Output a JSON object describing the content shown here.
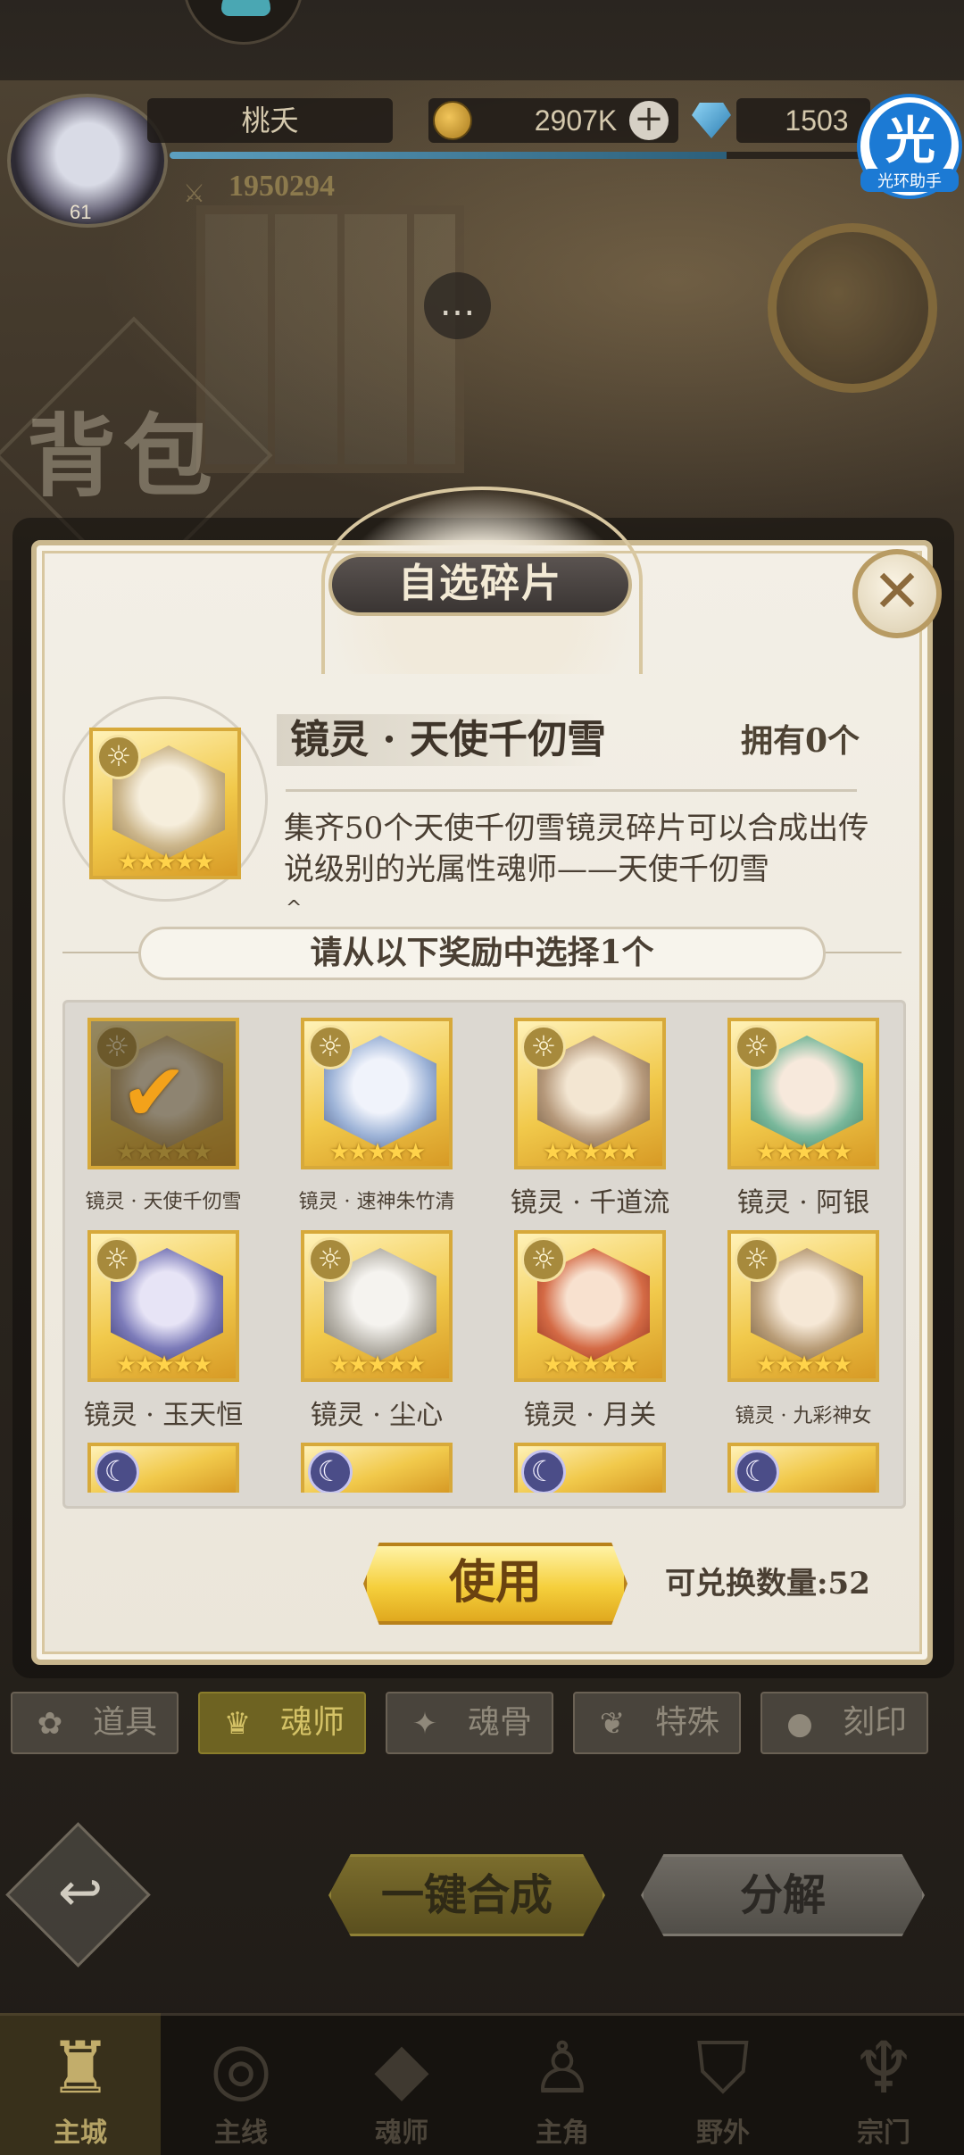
{
  "hud": {
    "player_name": "桃夭",
    "level": "61",
    "coins": "2907K",
    "gems": "1503",
    "power": "1950294",
    "exp_fraction": 0.8
  },
  "helper": {
    "glyph": "光",
    "label": "光环助手"
  },
  "page": {
    "title": "背包"
  },
  "dialog": {
    "title": "自选碎片",
    "close_glyph": "✕",
    "featured": {
      "name": "镜灵 · 天使千仞雪",
      "owned": "拥有0个",
      "description": "集齐50个天使千仞雪镜灵碎片可以合成出传说级别的光属性魂师——天使千仞雪",
      "stars": "★★★★★"
    },
    "choose_prompt": "请从以下奖励中选择1个",
    "items": [
      {
        "label": "镜灵 · 天使千仞雪",
        "element": "sun-icon",
        "selected": true
      },
      {
        "label": "镜灵 · 速神朱竹清",
        "element": "sun-icon",
        "selected": false
      },
      {
        "label": "镜灵 · 千道流",
        "element": "sun-icon",
        "selected": false
      },
      {
        "label": "镜灵 · 阿银",
        "element": "sun-icon",
        "selected": false
      },
      {
        "label": "镜灵 · 玉天恒",
        "element": "sun-icon",
        "selected": false
      },
      {
        "label": "镜灵 · 尘心",
        "element": "sun-icon",
        "selected": false
      },
      {
        "label": "镜灵 · 月关",
        "element": "sun-icon",
        "selected": false
      },
      {
        "label": "镜灵 · 九彩神女",
        "element": "sun-icon",
        "selected": false
      }
    ],
    "use_button": "使用",
    "exchange_count": "可兑换数量:52"
  },
  "tabs": [
    {
      "label": "道具",
      "icon": "item-icon",
      "active": false
    },
    {
      "label": "魂师",
      "icon": "soulmaster-icon",
      "active": true
    },
    {
      "label": "魂骨",
      "icon": "soulbone-icon",
      "active": false
    },
    {
      "label": "特殊",
      "icon": "special-icon",
      "active": false
    },
    {
      "label": "刻印",
      "icon": "imprint-icon",
      "active": false
    }
  ],
  "actions": {
    "merge_all": "一键合成",
    "decompose": "分解"
  },
  "nav": [
    {
      "label": "主城",
      "icon": "castle-icon",
      "active": true
    },
    {
      "label": "主线",
      "icon": "mainline-icon",
      "active": false
    },
    {
      "label": "魂师",
      "icon": "soulmaster-icon",
      "active": false
    },
    {
      "label": "主角",
      "icon": "hero-icon",
      "active": false
    },
    {
      "label": "野外",
      "icon": "wild-icon",
      "active": false
    },
    {
      "label": "宗门",
      "icon": "sect-icon",
      "active": false
    }
  ],
  "colors": {
    "gold_card": "#f1c94b",
    "selected_check": "#f3a21a",
    "helper_blue": "#1c7ad4",
    "active_tab": "#6e6322"
  }
}
